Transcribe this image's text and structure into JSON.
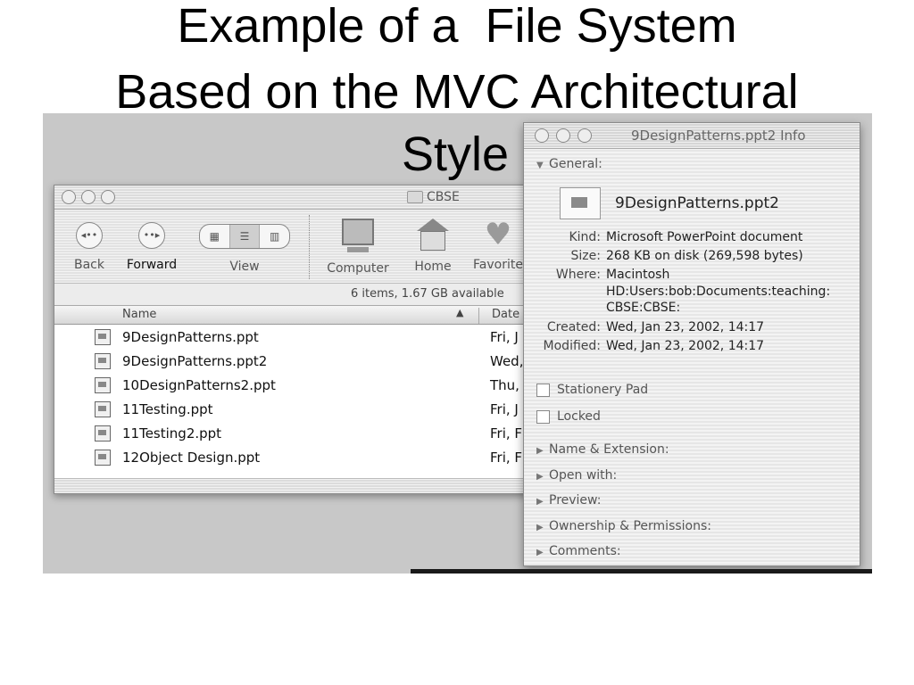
{
  "slide": {
    "title_lines": [
      "Example of a  File System",
      "Based on the MVC Architectural",
      "Style"
    ]
  },
  "finder": {
    "title": "CBSE",
    "toolbar": {
      "back": "Back",
      "forward": "Forward",
      "view": "View",
      "computer": "Computer",
      "home": "Home",
      "favorites": "Favorite"
    },
    "status": "6 items, 1.67 GB available",
    "columns": {
      "name": "Name",
      "date": "Date"
    },
    "files": [
      {
        "name": "9DesignPatterns.ppt",
        "date": "Fri, J"
      },
      {
        "name": "9DesignPatterns.ppt2",
        "date": "Wed,"
      },
      {
        "name": "10DesignPatterns2.ppt",
        "date": "Thu,"
      },
      {
        "name": "11Testing.ppt",
        "date": "Fri, J"
      },
      {
        "name": "11Testing2.ppt",
        "date": "Fri, F"
      },
      {
        "name": "12Object Design.ppt",
        "date": "Fri, F"
      }
    ]
  },
  "info": {
    "title": "9DesignPatterns.ppt2 Info",
    "general_label": "General:",
    "filename": "9DesignPatterns.ppt2",
    "kind_label": "Kind:",
    "kind": "Microsoft PowerPoint document",
    "size_label": "Size:",
    "size": "268 KB on disk (269,598 bytes)",
    "where_label": "Where:",
    "where_1": "Macintosh",
    "where_2": "HD:Users:bob:Documents:teaching:",
    "where_3": "CBSE:CBSE:",
    "created_label": "Created:",
    "created": "Wed, Jan 23, 2002, 14:17",
    "modified_label": "Modified:",
    "modified": "Wed, Jan 23, 2002, 14:17",
    "stationery": "Stationery Pad",
    "locked": "Locked",
    "sections": [
      "Name & Extension:",
      "Open with:",
      "Preview:",
      "Ownership & Permissions:",
      "Comments:"
    ]
  },
  "colors": {
    "window_bg": "#c8c8c8",
    "text": "#222222"
  }
}
